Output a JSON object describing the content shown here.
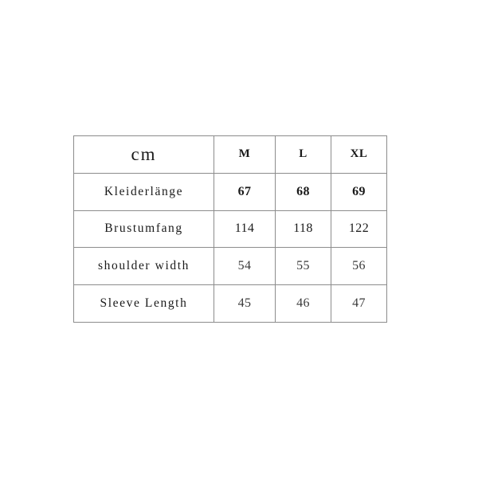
{
  "chart_data": {
    "type": "table",
    "title": "",
    "unit_label": "cm",
    "columns": [
      "cm",
      "M",
      "L",
      "XL"
    ],
    "size_columns": [
      "M",
      "L",
      "XL"
    ],
    "rows": [
      {
        "label": "Kleiderlänge",
        "values": [
          "67",
          "68",
          "69"
        ]
      },
      {
        "label": "Brustumfang",
        "values": [
          "114",
          "118",
          "122"
        ]
      },
      {
        "label": "shoulder width",
        "values": [
          "54",
          "55",
          "56"
        ]
      },
      {
        "label": "Sleeve Length",
        "values": [
          "45",
          "46",
          "47"
        ]
      }
    ]
  },
  "table": {
    "unit_label": "cm",
    "head_m": "M",
    "head_l": "L",
    "head_xl": "XL",
    "r0": {
      "label": "Kleiderlänge",
      "m": "67",
      "l": "68",
      "xl": "69"
    },
    "r1": {
      "label": "Brustumfang",
      "m": "114",
      "l": "118",
      "xl": "122"
    },
    "r2": {
      "label": "shoulder width",
      "m": "54",
      "l": "55",
      "xl": "56"
    },
    "r3": {
      "label": "Sleeve Length",
      "m": "45",
      "l": "46",
      "xl": "47"
    }
  },
  "colors": {
    "background": "#ffffff",
    "border": "#8c8c8c",
    "text": "#1a1a1a"
  }
}
